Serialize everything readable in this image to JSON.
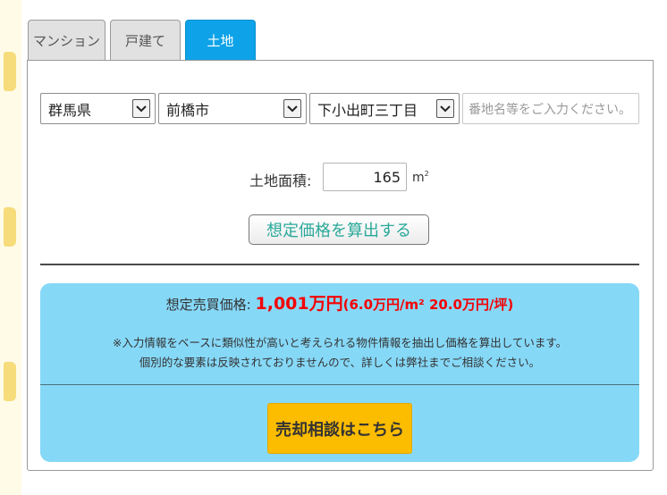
{
  "tabs": [
    {
      "label": "マンション",
      "active": false
    },
    {
      "label": "戸建て",
      "active": false
    },
    {
      "label": "土地",
      "active": true
    }
  ],
  "location": {
    "prefecture": "群馬県",
    "city": "前橋市",
    "town": "下小出町三丁目",
    "address_placeholder": "番地名等をご入力ください。"
  },
  "area": {
    "label": "土地面積:",
    "value": "165",
    "unit": "m",
    "unit_sup": "2"
  },
  "calc_button_label": "想定価格を算出する",
  "result": {
    "label": "想定売買価格:",
    "price": "1,001万円",
    "detail": "(6.0万円/m² 20.0万円/坪)",
    "note_line1": "※入力情報をベースに類似性が高いと考えられる物件情報を抽出し価格を算出しています。",
    "note_line2": "個別的な要素は反映されておりませんので、詳しくは弊社までご相談ください。",
    "consult_button_label": "売却相談はこちら"
  },
  "colors": {
    "active_tab": "#0ea3e8",
    "result_bg": "#86d8f7",
    "price": "#f40000",
    "consult_button": "#fcbc00",
    "calc_button_text": "#2aa99a"
  }
}
